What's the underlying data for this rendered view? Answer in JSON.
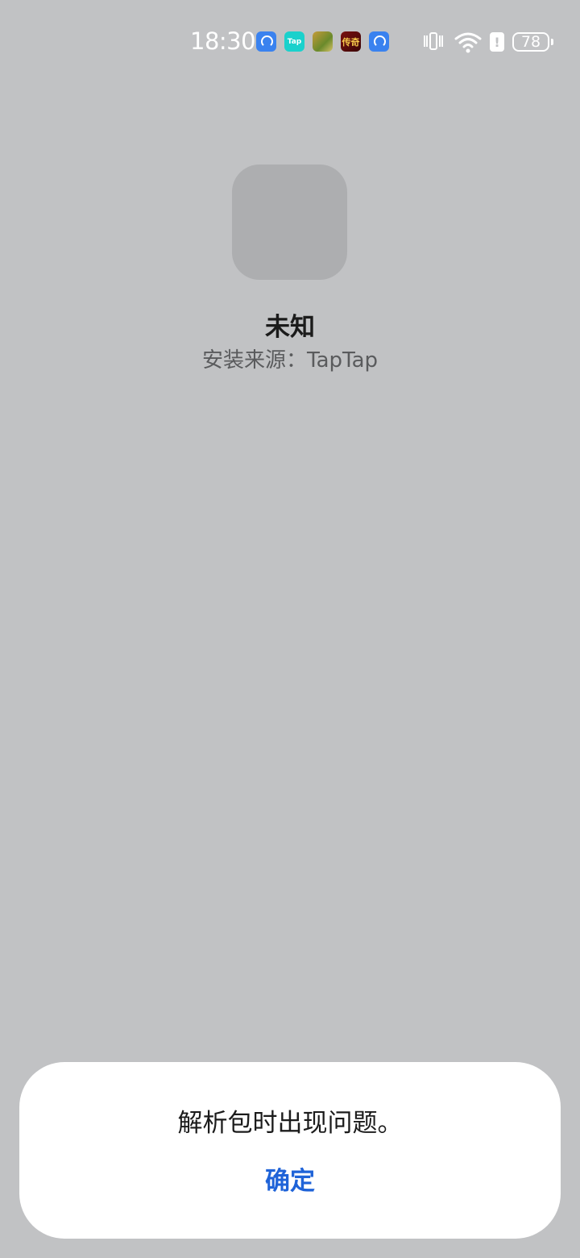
{
  "status_bar": {
    "time": "18:30",
    "battery_level": "78",
    "notification_icons": [
      "support-icon",
      "taptap-icon",
      "game-icon",
      "game-icon",
      "support-icon"
    ],
    "taptap_icon_text": "Tap",
    "game2_icon_text": "传奇"
  },
  "app": {
    "name": "未知",
    "install_source": "安装来源：TapTap"
  },
  "dialog": {
    "message": "解析包时出现问题。",
    "confirm_label": "确定",
    "confirm_color": "#1f63d8"
  }
}
